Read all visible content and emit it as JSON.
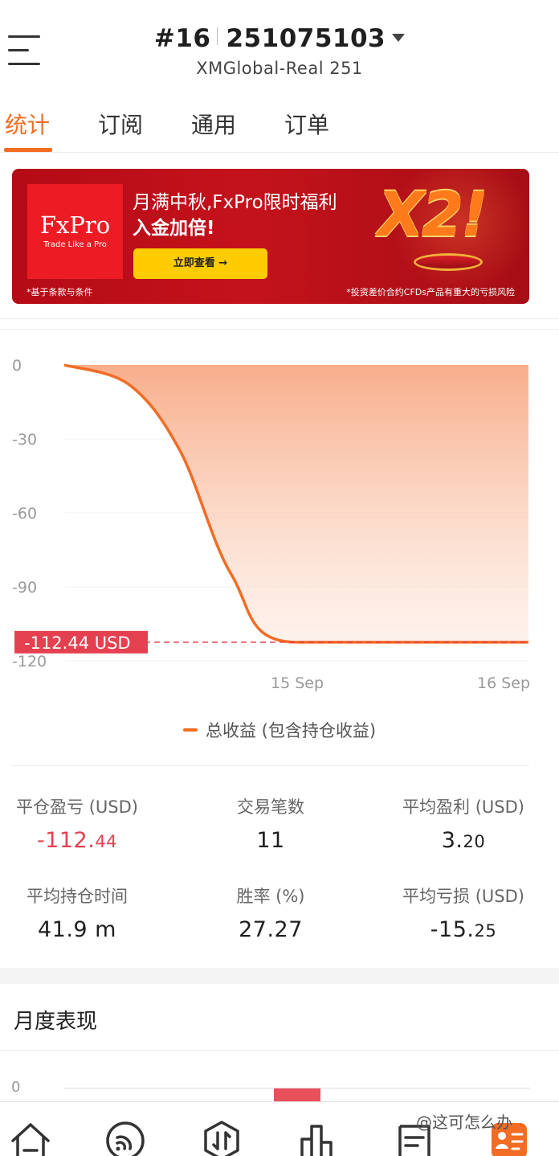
{
  "header": {
    "account_index": "#16",
    "account_number": "251075103",
    "server": "XMGlobal-Real 251"
  },
  "tabs": [
    {
      "label": "统计",
      "active": true
    },
    {
      "label": "订阅",
      "active": false
    },
    {
      "label": "通用",
      "active": false
    },
    {
      "label": "订单",
      "active": false
    }
  ],
  "banner": {
    "logo": "FxPro",
    "logo_tagline": "Trade Like a Pro",
    "headline_1": "月满中秋,FxPro限时福利",
    "headline_2": "入金加倍!",
    "cta": "立即查看 →",
    "promo": "X2!",
    "note_left": "*基于条款与条件",
    "note_right": "*投资差价合约CFDs产品有重大的亏损风险"
  },
  "chart_data": {
    "type": "area",
    "x_ticks": [
      "15 Sep",
      "16 Sep"
    ],
    "y_ticks": [
      "0",
      "-30",
      "-60",
      "-90",
      "-120"
    ],
    "ylim": [
      -120,
      0
    ],
    "series": [
      {
        "name": "总收益 (包含持仓收益)",
        "color": "#f26c24",
        "points": [
          [
            0,
            0
          ],
          [
            0.14,
            -8
          ],
          [
            0.25,
            -35
          ],
          [
            0.36,
            -85
          ],
          [
            0.5,
            -112.44
          ],
          [
            1.0,
            -112.44
          ]
        ]
      }
    ],
    "current_value_label": "-112.44 USD",
    "current_value": -112.44,
    "legend_label": "总收益 (包含持仓收益)",
    "legend_position": "bottom"
  },
  "stats": [
    {
      "label": "平仓盈亏 (USD)",
      "value_int": "-112.",
      "value_frac": "44",
      "negative": true
    },
    {
      "label": "交易笔数",
      "value_int": "11",
      "value_frac": "",
      "negative": false
    },
    {
      "label": "平均盈利 (USD)",
      "value_int": "3.",
      "value_frac": "20",
      "negative": false
    },
    {
      "label": "平均持仓时间",
      "value_int": "41.9 m",
      "value_frac": "",
      "negative": false
    },
    {
      "label": "胜率 (%)",
      "value_int": "27.27",
      "value_frac": "",
      "negative": false
    },
    {
      "label": "平均亏损 (USD)",
      "value_int": "-15.",
      "value_frac": "25",
      "negative": false
    }
  ],
  "monthly": {
    "title": "月度表现",
    "zero_label": "0"
  },
  "nav_icons": [
    "home-icon",
    "signal-icon",
    "trade-icon",
    "chart-icon",
    "orders-icon",
    "profile-icon"
  ],
  "watermark": "@这可怎么办",
  "colors": {
    "accent": "#f26c24",
    "negative": "#e54050",
    "banner_red": "#c4121c",
    "cta_yellow": "#ffcc00"
  }
}
